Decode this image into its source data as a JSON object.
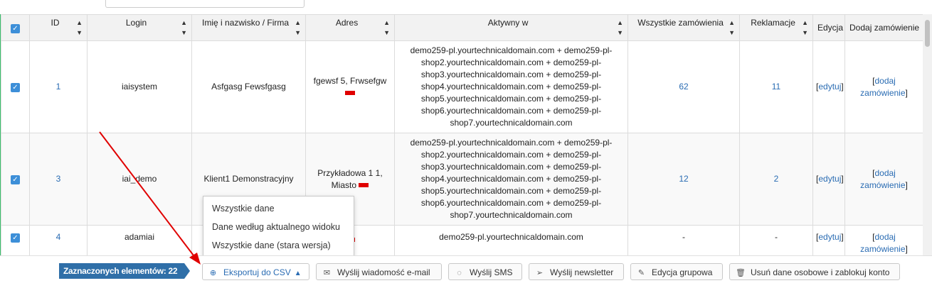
{
  "columns": {
    "id": "ID",
    "login": "Login",
    "name": "Imię i nazwisko / Firma",
    "address": "Adres",
    "active_in": "Aktywny w",
    "all_orders": "Wszystkie zamówienia",
    "complaints": "Reklamacje",
    "edit": "Edycja",
    "add_order": "Dodaj zamówienie"
  },
  "rows": [
    {
      "id": "1",
      "login": "iaisystem",
      "name": "Asfgasg Fewsfgasg",
      "address": "fgewsf 5, Frwsefgw",
      "active_lines": [
        "demo259-pl.yourtechnicaldomain.com + demo259-pl-",
        "shop2.yourtechnicaldomain.com + demo259-pl-",
        "shop3.yourtechnicaldomain.com + demo259-pl-",
        "shop4.yourtechnicaldomain.com + demo259-pl-",
        "shop5.yourtechnicaldomain.com + demo259-pl-",
        "shop6.yourtechnicaldomain.com + demo259-pl-",
        "shop7.yourtechnicaldomain.com"
      ],
      "orders": "62",
      "complaints": "11"
    },
    {
      "id": "3",
      "login": "iai_demo",
      "name": "Klient1 Demonstracyjny",
      "address_line1": "Przykładowa 1 1,",
      "address_line2": "Miasto",
      "active_lines": [
        "demo259-pl.yourtechnicaldomain.com + demo259-pl-",
        "shop2.yourtechnicaldomain.com + demo259-pl-",
        "shop3.yourtechnicaldomain.com + demo259-pl-",
        "shop4.yourtechnicaldomain.com + demo259-pl-",
        "shop5.yourtechnicaldomain.com + demo259-pl-",
        "shop6.yourtechnicaldomain.com + demo259-pl-",
        "shop7.yourtechnicaldomain.com"
      ],
      "orders": "12",
      "complaints": "2"
    },
    {
      "id": "4",
      "login": "adamiai",
      "active": "demo259-pl.yourtechnicaldomain.com",
      "orders": "-",
      "complaints": "-"
    }
  ],
  "links": {
    "edit": "edytuj",
    "add_word1": "dodaj",
    "add_word2": "zamówienie",
    "open": "[",
    "close": "]"
  },
  "dropdown": [
    "Wszystkie dane",
    "Dane według aktualnego widoku",
    "Wszystkie dane (stara wersja)"
  ],
  "footer": {
    "selected": "Zaznaczonych elementów: 22",
    "export": "Eksportuj do CSV",
    "email": "Wyślij wiadomość e-mail",
    "sms": "Wyślij SMS",
    "newsletter": "Wyślij newsletter",
    "group_edit": "Edycja grupowa",
    "delete": "Usuń dane osobowe i zablokuj konto"
  },
  "colors": {
    "accent": "#2f6fa8",
    "link": "#2a6cb3",
    "checkbox": "#3d8fd8",
    "annotation_arrow": "#e00000",
    "redaction": "#e00000"
  }
}
